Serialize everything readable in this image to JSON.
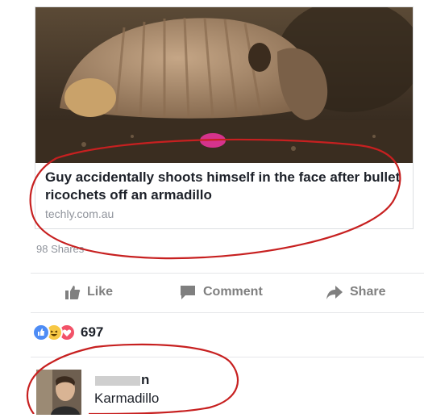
{
  "post": {
    "link": {
      "image_alt": "armadillo",
      "title": "Guy accidentally shoots himself in the face after bullet ricochets off an armadillo",
      "domain": "techly.com.au"
    },
    "shares": "98 Shares"
  },
  "actions": {
    "like": "Like",
    "comment": "Comment",
    "share": "Share"
  },
  "reactions": {
    "count": "697",
    "types": [
      "like-icon",
      "haha-icon",
      "love-icon"
    ],
    "colors": {
      "like": "#4e8cf5",
      "haha": "#f7c845",
      "love": "#f25268"
    }
  },
  "comment": {
    "name_visible": "n",
    "text": "Karmadillo"
  },
  "annotation": {
    "color": "#c72020"
  }
}
